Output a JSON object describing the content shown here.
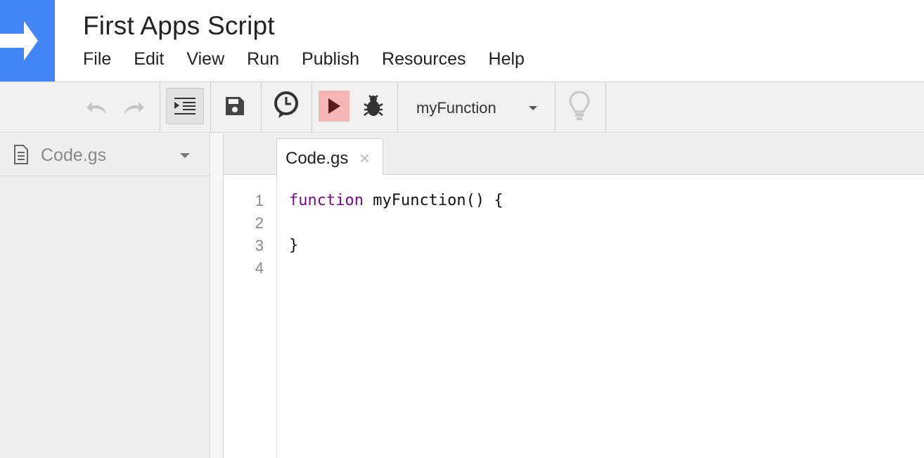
{
  "header": {
    "title": "First Apps Script",
    "menu": [
      "File",
      "Edit",
      "View",
      "Run",
      "Publish",
      "Resources",
      "Help"
    ]
  },
  "toolbar": {
    "undo_icon": "undo-icon",
    "redo_icon": "redo-icon",
    "indent_icon": "indent-icon",
    "save_icon": "save-icon",
    "triggers_icon": "clock-icon",
    "run_icon": "play-icon",
    "debug_icon": "bug-icon",
    "selected_function": "myFunction",
    "execution_hints_icon": "lightbulb-icon",
    "run_button_color": "#f4b6b4"
  },
  "sidebar": {
    "files": [
      {
        "name": "Code.gs",
        "icon": "document-icon"
      }
    ]
  },
  "editor": {
    "tabs": [
      {
        "label": "Code.gs",
        "close": "×"
      }
    ],
    "line_numbers": [
      "1",
      "2",
      "3",
      "4"
    ],
    "code": {
      "line1_keyword": "function",
      "line1_rest": " myFunction() {",
      "line2": "",
      "line3": "}",
      "line4": ""
    },
    "keyword_color": "#7a0a8c"
  },
  "colors": {
    "brand": "#4285f4"
  }
}
